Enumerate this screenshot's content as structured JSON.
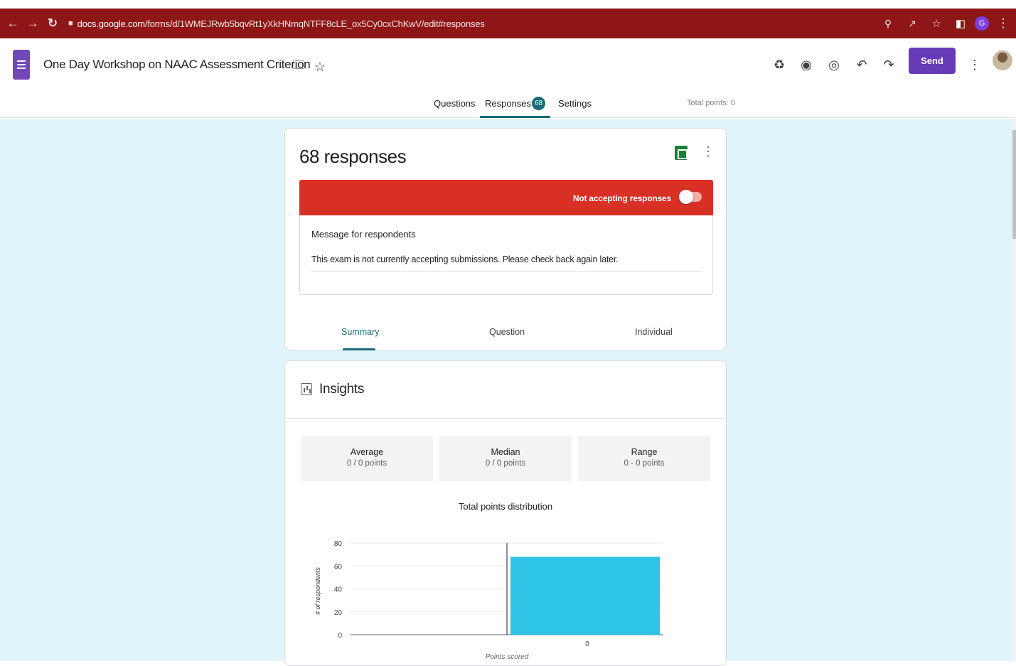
{
  "browser": {
    "url_host": "docs.google.com",
    "url_path": "/forms/d/1WMEJRwb5bqvRt1yXkHNmqNTFF8cLE_ox5Cy0cxChKwV/edit#responses",
    "profile_letter": "G"
  },
  "header": {
    "doc_title": "One Day Workshop on NAAC Assessment Criterion",
    "send_label": "Send"
  },
  "tabs": {
    "questions": "Questions",
    "responses": "Responses",
    "responses_count": "68",
    "settings": "Settings",
    "total_points": "Total points: 0"
  },
  "responses_card": {
    "heading": "68 responses",
    "accepting_label": "Not accepting responses",
    "accepting_on": false,
    "message_heading": "Message for respondents",
    "message_text": "This exam is not currently accepting submissions. Please check back again later.",
    "subtabs": {
      "summary": "Summary",
      "question": "Question",
      "individual": "Individual"
    }
  },
  "insights": {
    "title": "Insights",
    "stats": [
      {
        "label": "Average",
        "value": "0 / 0 points"
      },
      {
        "label": "Median",
        "value": "0 / 0 points"
      },
      {
        "label": "Range",
        "value": "0 - 0 points"
      }
    ]
  },
  "colors": {
    "browser_bar": "#8e1616",
    "accent": "#673ab7",
    "teal": "#1a6a78",
    "banner_red": "#d93025",
    "bar_color": "#2ec4e6",
    "page_bg": "#e0f5fb"
  },
  "chart_data": {
    "type": "bar",
    "title": "Total points distribution",
    "xlabel": "Points scored",
    "ylabel": "# of respondents",
    "categories": [
      "0"
    ],
    "values": [
      68
    ],
    "ylim": [
      0,
      80
    ],
    "yticks": [
      0,
      20,
      40,
      60,
      80
    ],
    "grid": true
  }
}
